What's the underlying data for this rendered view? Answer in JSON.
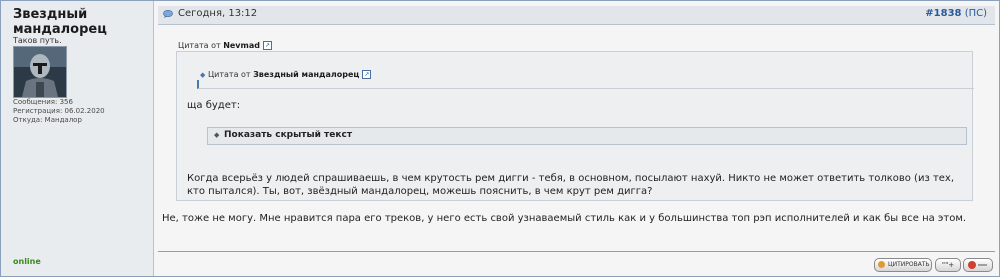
{
  "author": {
    "name": "Звездный мандалорец",
    "title": "Таков путь.",
    "messages": "Сообщения: 356",
    "registered": "Регистрация: 06.02.2020",
    "from": "Откуда: Мандалор",
    "status": "online"
  },
  "header": {
    "datetime": "Сегодня, 13:12",
    "post_number": "#1838",
    "pm_link": "(ПС)"
  },
  "outer_quote": {
    "prefix": "Цитата от",
    "author": "Nevmad",
    "inner_quote": {
      "prefix": "Цитата от",
      "author": "Звездный мандалорец"
    },
    "text_before_spoiler": "ща будет:",
    "spoiler_label": "Показать скрытый текст",
    "text_after_spoiler": "Когда всерьёз у людей спрашиваешь, в чем крутость рем дигги - тебя, в основном, посылают нахуй. Никто не может ответить толково (из тех, кто пытался). Ты, вот, звёздный мандалорец, можешь пояснить, в чем крут рем дигга?"
  },
  "post_text": "Не, тоже не могу. Мне нравится пара его треков, у него есть свой узнаваемый стиль как и у большинства топ рэп исполнителей и как бы все на этом.",
  "buttons": {
    "quote": "ЦИТИРОВАТЬ",
    "multiquote": "\"\"+"
  },
  "icons": {
    "post_time": "speech-bubble-icon",
    "view_post": "arrow-link-icon",
    "spoiler": "diamond-arrow-icon"
  }
}
